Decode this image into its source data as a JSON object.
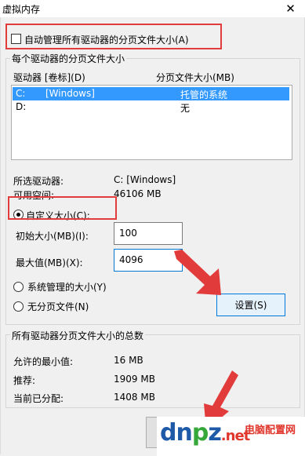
{
  "window": {
    "title": "虚拟内存",
    "close_glyph": "✕"
  },
  "auto_manage": {
    "label": "自动管理所有驱动器的分页文件大小(A)",
    "checked": false
  },
  "drive_group": {
    "title": "每个驱动器的分页文件大小",
    "col_drive": "驱动器 [卷标](D)",
    "col_size": "分页文件大小(MB)",
    "rows": [
      {
        "drive": "C:",
        "label": "[Windows]",
        "size": "托管的系统",
        "selected": true
      },
      {
        "drive": "D:",
        "label": "",
        "size": "无",
        "selected": false
      }
    ],
    "selected_drive_label": "所选驱动器:",
    "selected_drive_value": "C:  [Windows]",
    "free_space_label": "可用空间:",
    "free_space_value": "46106 MB",
    "custom_size_label": "自定义大小(C):",
    "initial_label": "初始大小(MB)(I):",
    "initial_value": "100",
    "max_label": "最大值(MB)(X):",
    "max_value": "4096",
    "system_managed_label": "系统管理的大小(Y)",
    "no_paging_label": "无分页文件(N)",
    "set_button": "设置(S)"
  },
  "totals_group": {
    "title": "所有驱动器分页文件大小的总数",
    "min_label": "允许的最小值:",
    "min_value": "16 MB",
    "recommended_label": "推荐:",
    "recommended_value": "1909 MB",
    "allocated_label": "当前已分配:",
    "allocated_value": "1408 MB"
  },
  "watermark": {
    "brand": "dnpz.net",
    "site_name": "电脑配置网"
  },
  "colors": {
    "selection": "#3399ff",
    "annotation_red": "#e23b3b",
    "focus_blue": "#0078d7"
  }
}
